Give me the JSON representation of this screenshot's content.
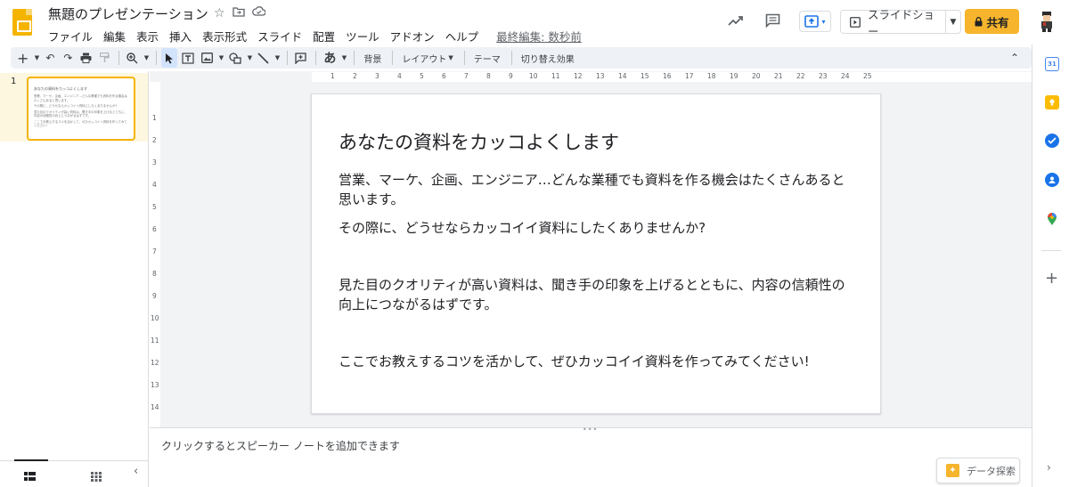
{
  "app": {
    "doc_title": "無題のプレゼンテーション",
    "menus": [
      "ファイル",
      "編集",
      "表示",
      "挿入",
      "表示形式",
      "スライド",
      "配置",
      "ツール",
      "アドオン",
      "ヘルプ"
    ],
    "last_edit": "最終編集: 数秒前",
    "present_label": "スライドショー",
    "share_label": "共有",
    "brand_color": "#f4b400",
    "share_color": "#f6b52c"
  },
  "toolbar": {
    "background_label": "背景",
    "layout_label": "レイアウト",
    "theme_label": "テーマ",
    "transition_label": "切り替え効果",
    "text_style_glyph": "あ"
  },
  "rulers": {
    "horizontal": [
      "1",
      "2",
      "3",
      "4",
      "5",
      "6",
      "7",
      "8",
      "9",
      "10",
      "11",
      "12",
      "13",
      "14",
      "15",
      "16",
      "17",
      "18",
      "19",
      "20",
      "21",
      "22",
      "23",
      "24",
      "25"
    ],
    "vertical": [
      "1",
      "2",
      "3",
      "4",
      "5",
      "6",
      "7",
      "8",
      "9",
      "10",
      "11",
      "12",
      "13",
      "14"
    ]
  },
  "filmstrip": {
    "slide_number": "1"
  },
  "slide": {
    "title": "あなたの資料をカッコよくします",
    "paragraphs": [
      "営業、マーケ、企画、エンジニア…どんな業種でも資料を作る機会はたくさんあると思います。",
      "その際に、どうせならカッコイイ資料にしたくありませんか?",
      "見た目のクオリティが高い資料は、聞き手の印象を上げるとともに、内容の信頼性の向上につながるはずです。",
      "ここでお教えするコツを活かして、ぜひカッコイイ資料を作ってみてください!"
    ]
  },
  "notes": {
    "placeholder": "クリックするとスピーカー ノートを追加できます",
    "explore_label": "データ探索"
  }
}
